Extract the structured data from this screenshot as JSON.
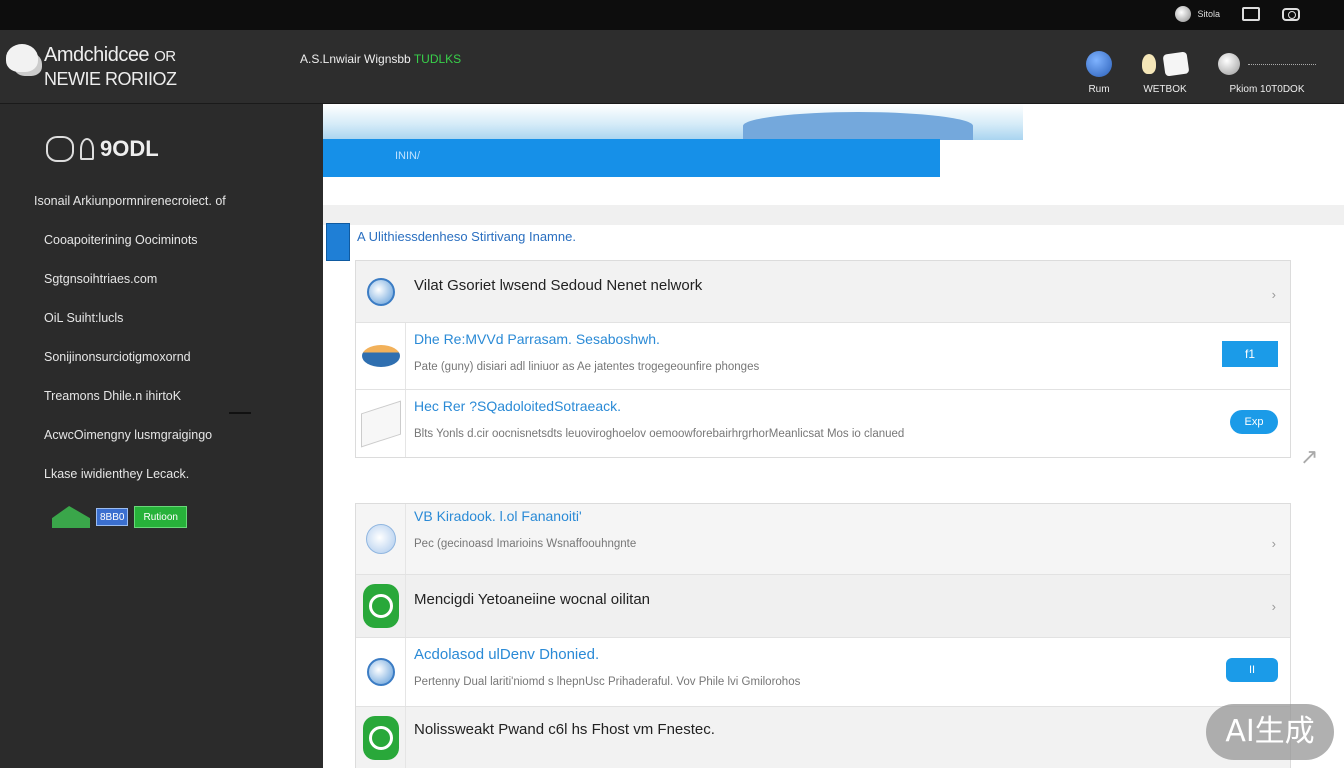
{
  "system_bar": {
    "tray_label": "Sitola"
  },
  "header": {
    "brand_line1": "Amdchidcee",
    "brand_line1b": "OR",
    "brand_line2": "NEWIE RORIIOZ",
    "tagline_text": "A.S.Lnwiair Wignsbb",
    "tagline_accent": "TUDLKS",
    "actions": [
      {
        "label": "Rum"
      },
      {
        "label": "WETBOK"
      },
      {
        "label": "Pkiom 10T0DOK"
      }
    ]
  },
  "sidebar": {
    "logo_text": "9ODL",
    "items": [
      {
        "label": "Isonail Arkiunpormnirenecroiect. of"
      },
      {
        "label": "Cooapoiterining Oociminots"
      },
      {
        "label": "Sgtgnsoihtriaes.com"
      },
      {
        "label": "OiL Suiht:lucls"
      },
      {
        "label": "Sonijinonsurciotigmoxornd"
      },
      {
        "label": "Treamons Dhile.n ihirtoK"
      },
      {
        "label": "AcwcOimengny lusmgraigingo"
      },
      {
        "label": "Lkase iwidienthey Lecack."
      }
    ],
    "badge_blue": "8BB0",
    "badge_green": "Rutioon"
  },
  "main": {
    "banner_text": "ININ/",
    "section_title": "A Ulithiessdenheso Stirtivang Inamne.",
    "card1": {
      "head_title": "Vilat Gsoriet lwsend Sedoud Nenet nelwork",
      "rows": [
        {
          "link": "Dhe  Re:MVVd Parrasam. Sesaboshwh.",
          "desc": "Pate  (guny) disiari adl liniuor as Ae jatentes trogegeounfire phonges",
          "button": "f1"
        },
        {
          "link": "Hec  Rer ?SQadoloitedSotraeack.",
          "desc": "Blts   Yonls     d.cir    oocnisnetsdts leuoviroghoelov oemoowforebairhrgrhorMeanlicsat  Mos io   clanued",
          "button": "Exp"
        }
      ]
    },
    "card2": {
      "rows": [
        {
          "link": "VB  Kiradook.  l.ol Fananoiti'",
          "desc": "Pec  (gecinoasd  Imarioins Wsnaffoouhngnte"
        },
        {
          "title": "Mencigdi Yetoaneiine wocnal oilitan"
        },
        {
          "link": "Acdolasod ulDenv Dhonied.",
          "desc": "Pertenny  Dual lariti'niomd s  lhepnUsc Prihaderaful. Vov Phile lvi Gmilorohos",
          "button": "II"
        },
        {
          "title": "Nolissweakt Pwand c6l hs Fhost vm Fnestec."
        }
      ]
    }
  },
  "watermark": "AI生成"
}
